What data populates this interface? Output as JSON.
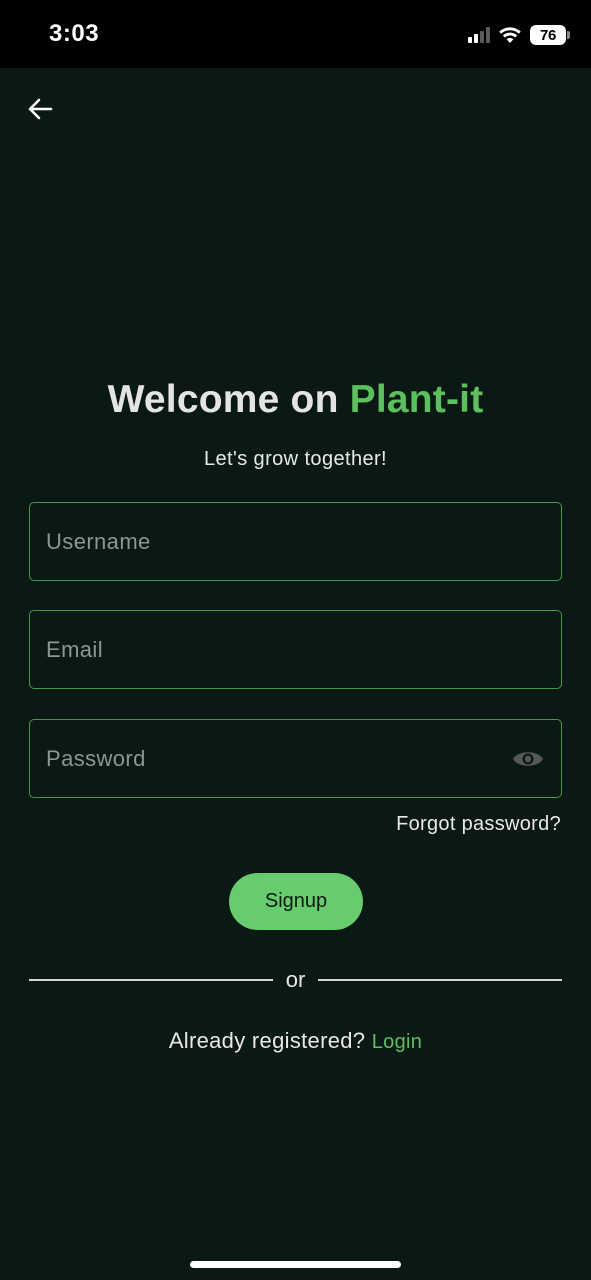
{
  "status_bar": {
    "time": "3:03",
    "battery": "76",
    "icons": [
      "signal-icon",
      "wifi-icon",
      "battery-icon"
    ]
  },
  "header": {
    "back_icon": "arrow-left-icon"
  },
  "welcome": {
    "title_prefix": "Welcome on ",
    "title_brand": "Plant-it",
    "subtitle": "Let's grow together!"
  },
  "form": {
    "username": {
      "placeholder": "Username",
      "value": ""
    },
    "email": {
      "placeholder": "Email",
      "value": ""
    },
    "password": {
      "placeholder": "Password",
      "value": "",
      "toggle_icon": "eye-icon"
    },
    "forgot_password": "Forgot password?",
    "signup_label": "Signup"
  },
  "divider": {
    "label": "or"
  },
  "footer": {
    "already_text": "Already registered?",
    "login_label": "Login"
  },
  "colors": {
    "background": "#0a1913",
    "accent": "#5dc05f",
    "button": "#66cc6e",
    "field_border": "#3e9a4a"
  }
}
